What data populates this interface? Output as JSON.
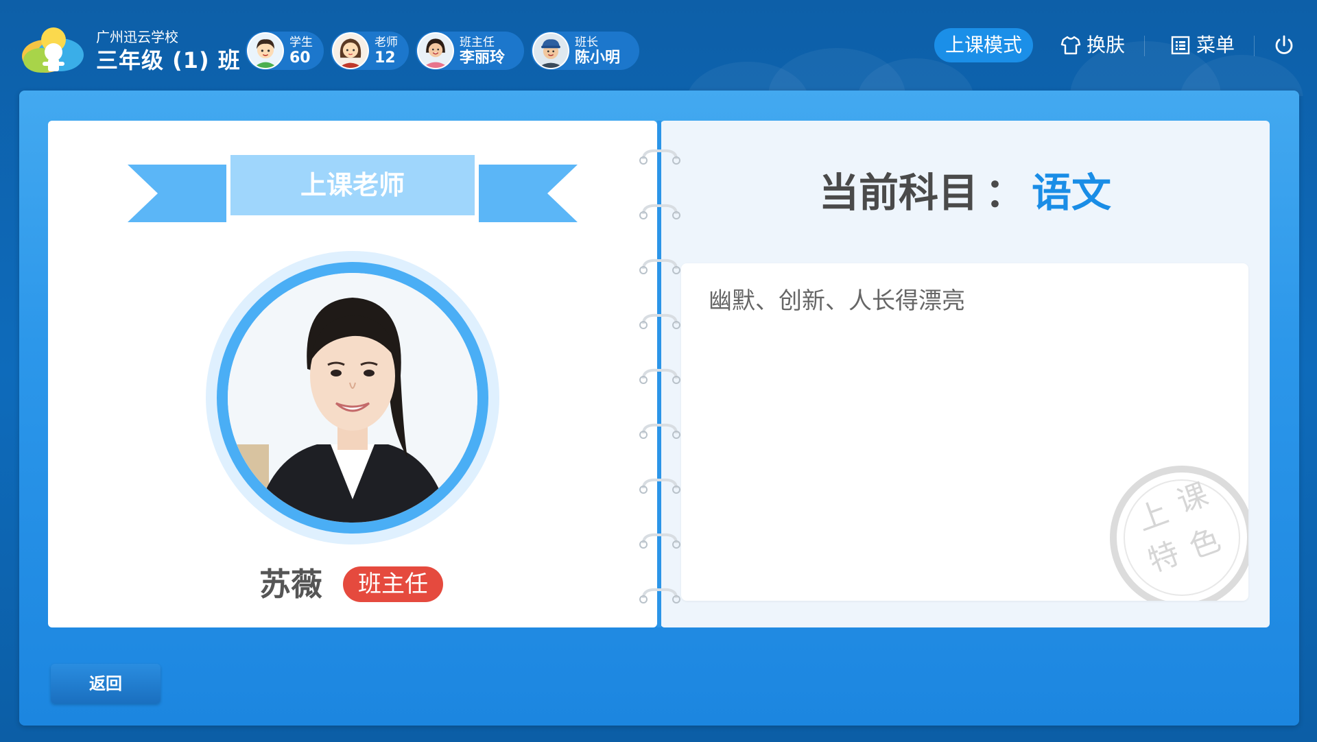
{
  "header": {
    "school_name": "广州迅云学校",
    "class_name": "三年级 (1) 班",
    "stats": [
      {
        "label": "学生",
        "value": "60",
        "avatar": "student-avatar"
      },
      {
        "label": "老师",
        "value": "12",
        "avatar": "teacher-avatar"
      },
      {
        "label": "班主任",
        "value": "李丽玲",
        "avatar": "head-teacher-avatar"
      },
      {
        "label": "班长",
        "value": "陈小明",
        "avatar": "monitor-avatar"
      }
    ],
    "mode_label": "上课模式",
    "skin_label": "换肤",
    "menu_label": "菜单"
  },
  "teacher_card": {
    "ribbon_title": "上课老师",
    "name": "苏薇",
    "role": "班主任"
  },
  "subject": {
    "label": "当前科目",
    "colon": "：",
    "value": "语文",
    "description": "幽默、创新、人长得漂亮",
    "stamp_text": "上课特色"
  },
  "footer": {
    "back_label": "返回"
  },
  "colors": {
    "accent": "#1a8de6",
    "role_badge": "#e54a3e",
    "board": "#2c97ea"
  }
}
